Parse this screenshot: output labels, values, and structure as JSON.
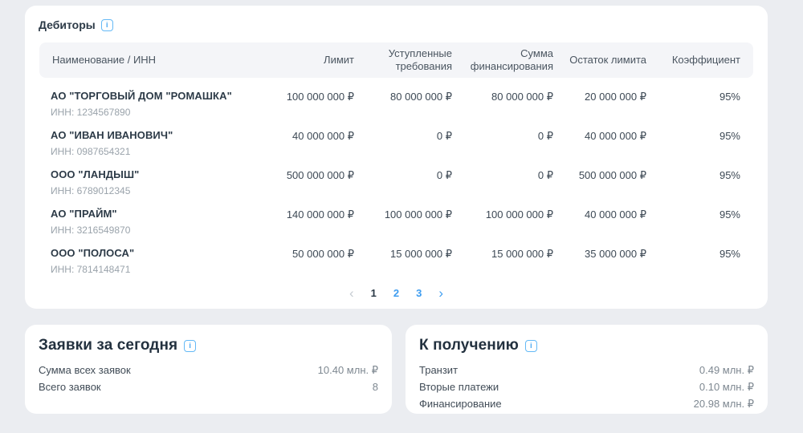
{
  "colors": {
    "page_bg": "#EBEDF1",
    "card_bg": "#FFFFFF",
    "table_header_bg": "#F4F5F8",
    "text_dark": "#2C3A47",
    "text_secondary": "#9AA3AB",
    "link_blue": "#3E9DF0",
    "info_icon_blue": "#64B9F6",
    "disabled_gray": "#C5CBD1"
  },
  "debtors": {
    "title": "Дебиторы",
    "info_glyph": "i",
    "columns": {
      "name": "Наименование / ИНН",
      "limit": "Лимит",
      "ceded": "Уступленные требования",
      "financing": "Сумма финансирования",
      "remaining": "Остаток лимита",
      "coefficient": "Коэффициент"
    },
    "rows": [
      {
        "name": "АО \"ТОРГОВЫЙ ДОМ \"РОМАШКА\"",
        "inn": "ИНН: 1234567890",
        "limit": "100 000 000 ₽",
        "ceded": "80 000 000 ₽",
        "financing": "80 000 000 ₽",
        "remaining": "20 000 000 ₽",
        "coefficient": "95%"
      },
      {
        "name": "АО \"ИВАН ИВАНОВИЧ\"",
        "inn": "ИНН: 0987654321",
        "limit": "40 000 000 ₽",
        "ceded": "0 ₽",
        "financing": "0 ₽",
        "remaining": "40 000 000 ₽",
        "coefficient": "95%"
      },
      {
        "name": "ООО \"ЛАНДЫШ\"",
        "inn": "ИНН: 6789012345",
        "limit": "500 000 000 ₽",
        "ceded": "0 ₽",
        "financing": "0 ₽",
        "remaining": "500 000 000 ₽",
        "coefficient": "95%"
      },
      {
        "name": "АО \"ПРАЙМ\"",
        "inn": "ИНН: 3216549870",
        "limit": "140 000 000 ₽",
        "ceded": "100 000 000 ₽",
        "financing": "100 000 000 ₽",
        "remaining": "40 000 000 ₽",
        "coefficient": "95%"
      },
      {
        "name": "ООО \"ПОЛОСА\"",
        "inn": "ИНН: 7814148471",
        "limit": "50 000 000 ₽",
        "ceded": "15 000 000 ₽",
        "financing": "15 000 000 ₽",
        "remaining": "35 000 000 ₽",
        "coefficient": "95%"
      }
    ],
    "pagination": {
      "prev_glyph": "‹",
      "pages": [
        "1",
        "2",
        "3"
      ],
      "current_page": "1",
      "next_glyph": "›"
    }
  },
  "today_requests": {
    "title": "Заявки за сегодня",
    "info_glyph": "i",
    "rows": [
      {
        "label": "Сумма всех заявок",
        "value": "10.40 млн. ₽"
      },
      {
        "label": "Всего заявок",
        "value": "8"
      }
    ]
  },
  "to_receive": {
    "title": "К получению",
    "info_glyph": "i",
    "rows": [
      {
        "label": "Транзит",
        "value": "0.49 млн. ₽"
      },
      {
        "label": "Вторые платежи",
        "value": "0.10 млн. ₽"
      },
      {
        "label": "Финансирование",
        "value": "20.98 млн. ₽"
      }
    ]
  }
}
